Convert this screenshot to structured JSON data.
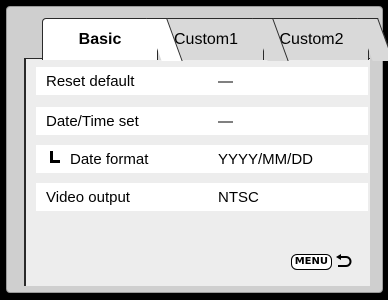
{
  "tabs": [
    {
      "label": "Basic",
      "active": true
    },
    {
      "label": "Custom1",
      "active": false
    },
    {
      "label": "Custom2",
      "active": false
    }
  ],
  "rows": [
    {
      "label": "Reset default",
      "value": "—"
    },
    {
      "label": "Date/Time set",
      "value": "—"
    },
    {
      "label": "Date format",
      "value": "YYYY/MM/DD"
    },
    {
      "label": "Video output",
      "value": "NTSC"
    }
  ],
  "footer": {
    "menu_label": "MENU",
    "back_icon": "return-arrow-icon"
  },
  "colors": {
    "background": "#000000",
    "panel": "#cfcfcf",
    "content": "#ededed",
    "row": "#ffffff",
    "active_tab": "#ffffff"
  }
}
